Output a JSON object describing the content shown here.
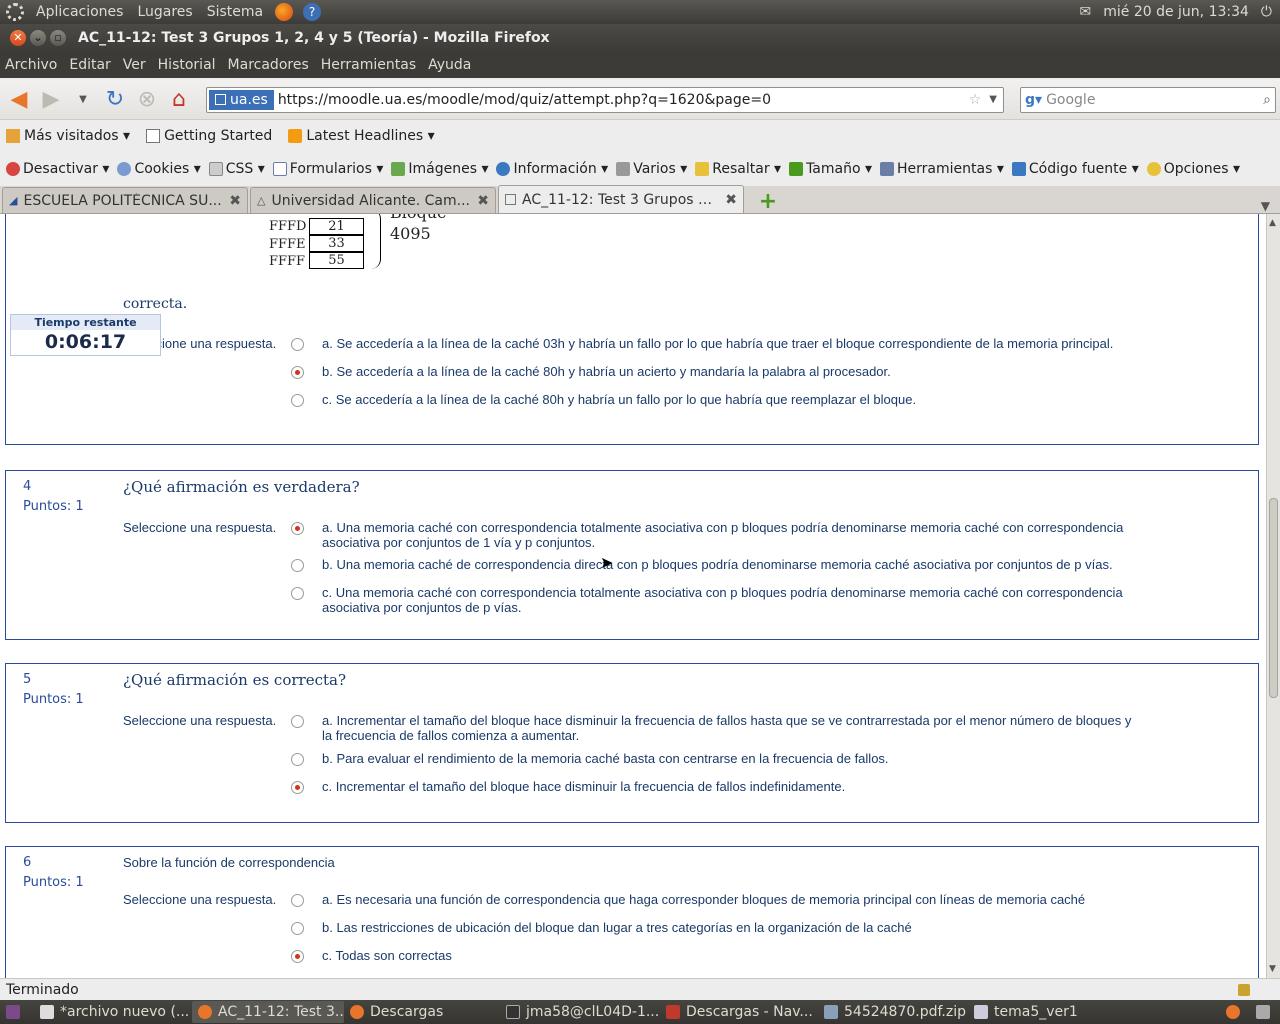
{
  "gnome_panel": {
    "menus": [
      "Aplicaciones",
      "Lugares",
      "Sistema"
    ],
    "clock": "mié 20 de jun, 13:34"
  },
  "window": {
    "title": "AC_11-12: Test 3 Grupos 1, 2, 4 y 5 (Teoría) - Mozilla Firefox"
  },
  "menubar": [
    "Archivo",
    "Editar",
    "Ver",
    "Historial",
    "Marcadores",
    "Herramientas",
    "Ayuda"
  ],
  "navbar": {
    "site_badge": "ua.es",
    "url": "https://moodle.ua.es/moodle/mod/quiz/attempt.php?q=1620&page=0",
    "search_placeholder": "Google"
  },
  "bookmarks": [
    "Más visitados ▾",
    "Getting Started",
    "Latest Headlines ▾"
  ],
  "devbar": [
    "Desactivar ▾",
    "Cookies ▾",
    "CSS ▾",
    "Formularios ▾",
    "Imágenes ▾",
    "Información ▾",
    "Varios ▾",
    "Resaltar ▾",
    "Tamaño ▾",
    "Herramientas ▾",
    "Código fuente ▾",
    "Opciones ▾"
  ],
  "tabs": [
    {
      "label": "ESCUELA POLITÉCNICA SU...",
      "active": false
    },
    {
      "label": "Universidad Alicante. Cam...",
      "active": false
    },
    {
      "label": "AC_11-12: Test 3 Grupos 1,...",
      "active": true
    }
  ],
  "timer": {
    "label": "Tiempo restante",
    "value": "0:06:17"
  },
  "memory_image": {
    "rows": [
      {
        "addr": "FFFD",
        "val": "21"
      },
      {
        "addr": "FFFE",
        "val": "33"
      },
      {
        "addr": "FFFF",
        "val": "55"
      }
    ],
    "label_top": "Bloque",
    "label_bottom": "4095"
  },
  "q3": {
    "trailing_text": "correcta.",
    "prompt": "Seleccione una respuesta.",
    "options": [
      {
        "text": "a. Se accedería a la línea de la caché 03h y habría un fallo por lo que habría que traer el bloque correspondiente de la memoria principal.",
        "selected": false
      },
      {
        "text": "b. Se accedería a la línea de la caché 80h y habría un acierto y mandaría la palabra al procesador.",
        "selected": true
      },
      {
        "text": "c. Se accedería a la línea de la caché 80h y habría un fallo por lo que habría que reemplazar el bloque.",
        "selected": false
      }
    ]
  },
  "q4": {
    "number": "4",
    "points": "Puntos: 1",
    "question": "¿Qué afirmación es verdadera?",
    "prompt": "Seleccione una respuesta.",
    "options": [
      {
        "text": "a. Una memoria caché con correspondencia totalmente asociativa con p bloques podría denominarse memoria caché con correspondencia asociativa por conjuntos de 1 vía y p conjuntos.",
        "selected": true
      },
      {
        "text": "b. Una memoria caché de correspondencia directa con p bloques podría denominarse memoria caché asociativa por conjuntos de p vías.",
        "selected": false
      },
      {
        "text": "c. Una memoria caché con correspondencia totalmente asociativa con p bloques podría denominarse memoria caché con correspondencia asociativa por conjuntos de p vías.",
        "selected": false
      }
    ]
  },
  "q5": {
    "number": "5",
    "points": "Puntos: 1",
    "question": "¿Qué afirmación es correcta?",
    "prompt": "Seleccione una respuesta.",
    "options": [
      {
        "text": "a. Incrementar el tamaño del bloque hace disminuir la frecuencia de fallos hasta que se ve contrarrestada por el menor número de bloques y la frecuencia de fallos comienza a aumentar.",
        "selected": false
      },
      {
        "text": "b. Para evaluar el rendimiento de la memoria caché basta con centrarse en la frecuencia de fallos.",
        "selected": false
      },
      {
        "text": "c. Incrementar el tamaño del bloque hace disminuir la frecuencia de fallos indefinidamente.",
        "selected": true
      }
    ]
  },
  "q6": {
    "number": "6",
    "points": "Puntos: 1",
    "question": "Sobre la función de correspondencia",
    "prompt": "Seleccione una respuesta.",
    "options": [
      {
        "text": "a. Es necesaria una función de correspondencia que haga corresponder bloques de memoria principal con líneas de memoria caché",
        "selected": false
      },
      {
        "text": "b. Las restricciones de ubicación del bloque dan lugar a tres categorías en la organización de la caché",
        "selected": false
      },
      {
        "text": "c. Todas son correctas",
        "selected": true
      }
    ]
  },
  "status": "Terminado",
  "taskbar": [
    "*archivo nuevo (...",
    "AC_11-12: Test 3...",
    "Descargas",
    "jma58@clL04D-1...",
    "Descargas - Nav...",
    "54524870.pdf.zip",
    "tema5_ver1"
  ],
  "colors": {
    "accent": "#2a4b9b",
    "radio_selected": "#d1331c",
    "panel": "#3c3b37"
  }
}
